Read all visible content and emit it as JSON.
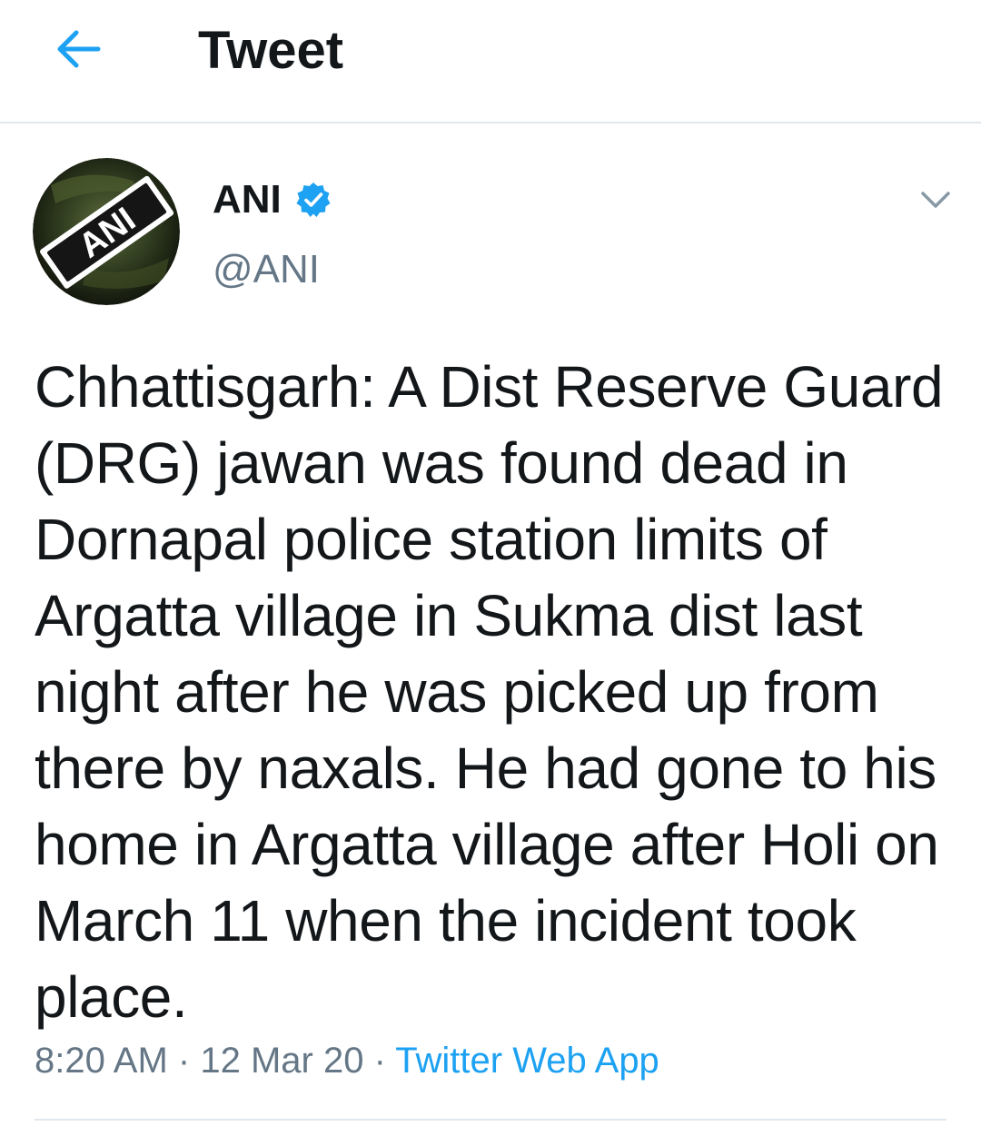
{
  "header": {
    "title": "Tweet",
    "back_icon": "arrow-left-icon"
  },
  "author": {
    "name": "ANI",
    "handle": "@ANI",
    "avatar_text": "ANI",
    "verified_icon": "verified-badge-icon"
  },
  "menu_icon": "chevron-down-icon",
  "tweet": {
    "text": "Chhattisgarh: A Dist Reserve Guard (DRG) jawan was found dead in Dornapal police station limits of Argatta village in Sukma dist last night after he was picked up from there by naxals. He had gone to his home in Argatta village after Holi on March 11 when the incident took place.",
    "time": "8:20 AM",
    "date": "12 Mar 20",
    "separator": "·",
    "source": "Twitter Web App"
  },
  "colors": {
    "accent": "#1da1f2",
    "text": "#14171a",
    "secondary": "#657786",
    "divider": "#e1e8ed"
  }
}
